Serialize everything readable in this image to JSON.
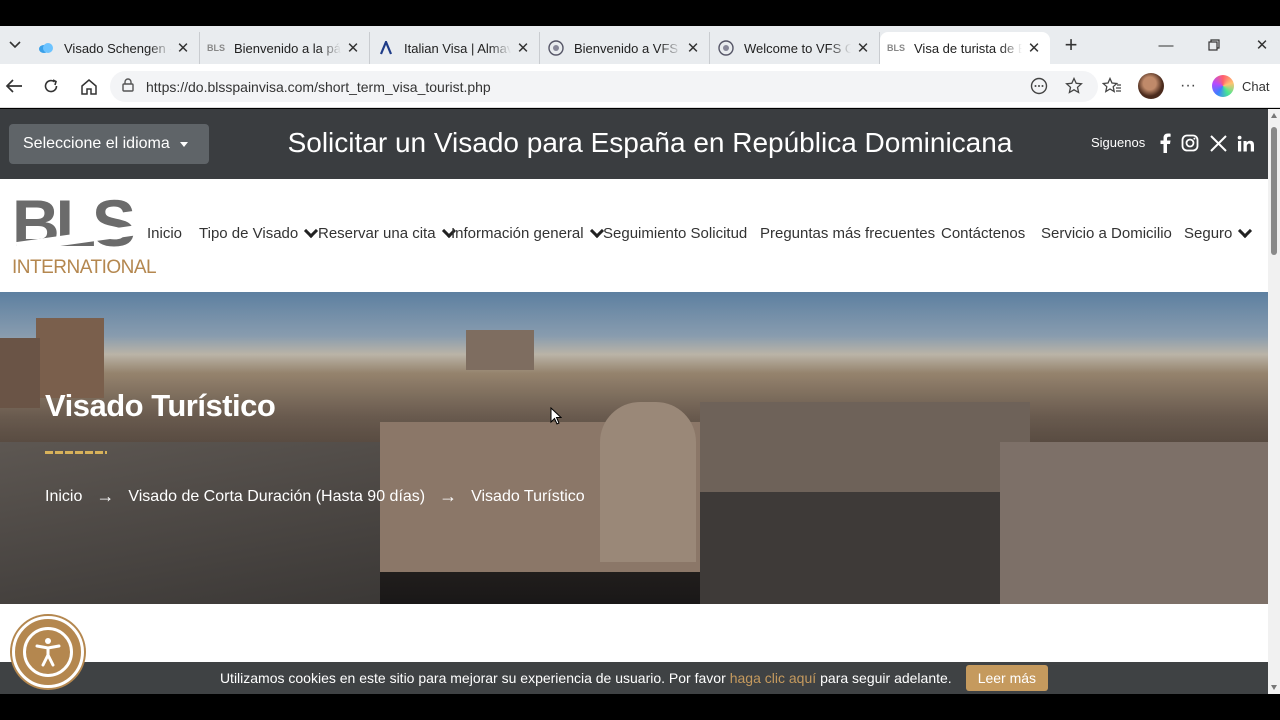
{
  "browser": {
    "tabs": [
      {
        "title": "Visado Schengen - ¿",
        "favicon": "cloud-icon",
        "active": false
      },
      {
        "title": "Bienvenido a la pági",
        "favicon": "bls-icon",
        "active": false
      },
      {
        "title": "Italian Visa | Almavi",
        "favicon": "almaviva-icon",
        "active": false
      },
      {
        "title": "Bienvenido a VFS Gl",
        "favicon": "vfs-icon",
        "active": false
      },
      {
        "title": "Welcome to VFS Glo",
        "favicon": "vfs-icon",
        "active": false
      },
      {
        "title": "Visa de turista de Es",
        "favicon": "bls-icon",
        "active": true
      }
    ],
    "url": "https://do.blsspainvisa.com/short_term_visa_tourist.php",
    "chat_label": "Chat"
  },
  "header": {
    "language_select": "Seleccione el idioma",
    "headline": "Solicitar un Visado para España en República Dominicana",
    "follow_label": "Siguenos",
    "social": [
      "f",
      "instagram",
      "X",
      "in"
    ]
  },
  "logo": {
    "top": "BLS",
    "bottom": "INTERNATIONAL"
  },
  "nav": {
    "items": [
      {
        "label": "Inicio",
        "dropdown": false
      },
      {
        "label": "Tipo de Visado",
        "dropdown": true
      },
      {
        "label": "Reservar una cita",
        "dropdown": true
      },
      {
        "label": "Información general",
        "dropdown": true
      },
      {
        "label": "Seguimiento Solicitud",
        "dropdown": false
      },
      {
        "label": "Preguntas más frecuentes",
        "dropdown": false
      },
      {
        "label": "Contáctenos",
        "dropdown": false
      },
      {
        "label": "Servicio a Domicilio",
        "dropdown": false
      },
      {
        "label": "Seguro",
        "dropdown": true
      }
    ]
  },
  "hero": {
    "title": "Visado Turístico",
    "breadcrumb": [
      "Inicio",
      "Visado de Corta Duración (Hasta 90 días)",
      "Visado Turístico"
    ]
  },
  "cookie": {
    "text_before": "Utilizamos cookies en este sitio para mejorar su experiencia de usuario. Por favor",
    "link": "haga clic aquí",
    "text_after": "para seguir adelante.",
    "button": "Leer más"
  },
  "colors": {
    "accent": "#c59a5e",
    "dark": "#3a3d40"
  }
}
